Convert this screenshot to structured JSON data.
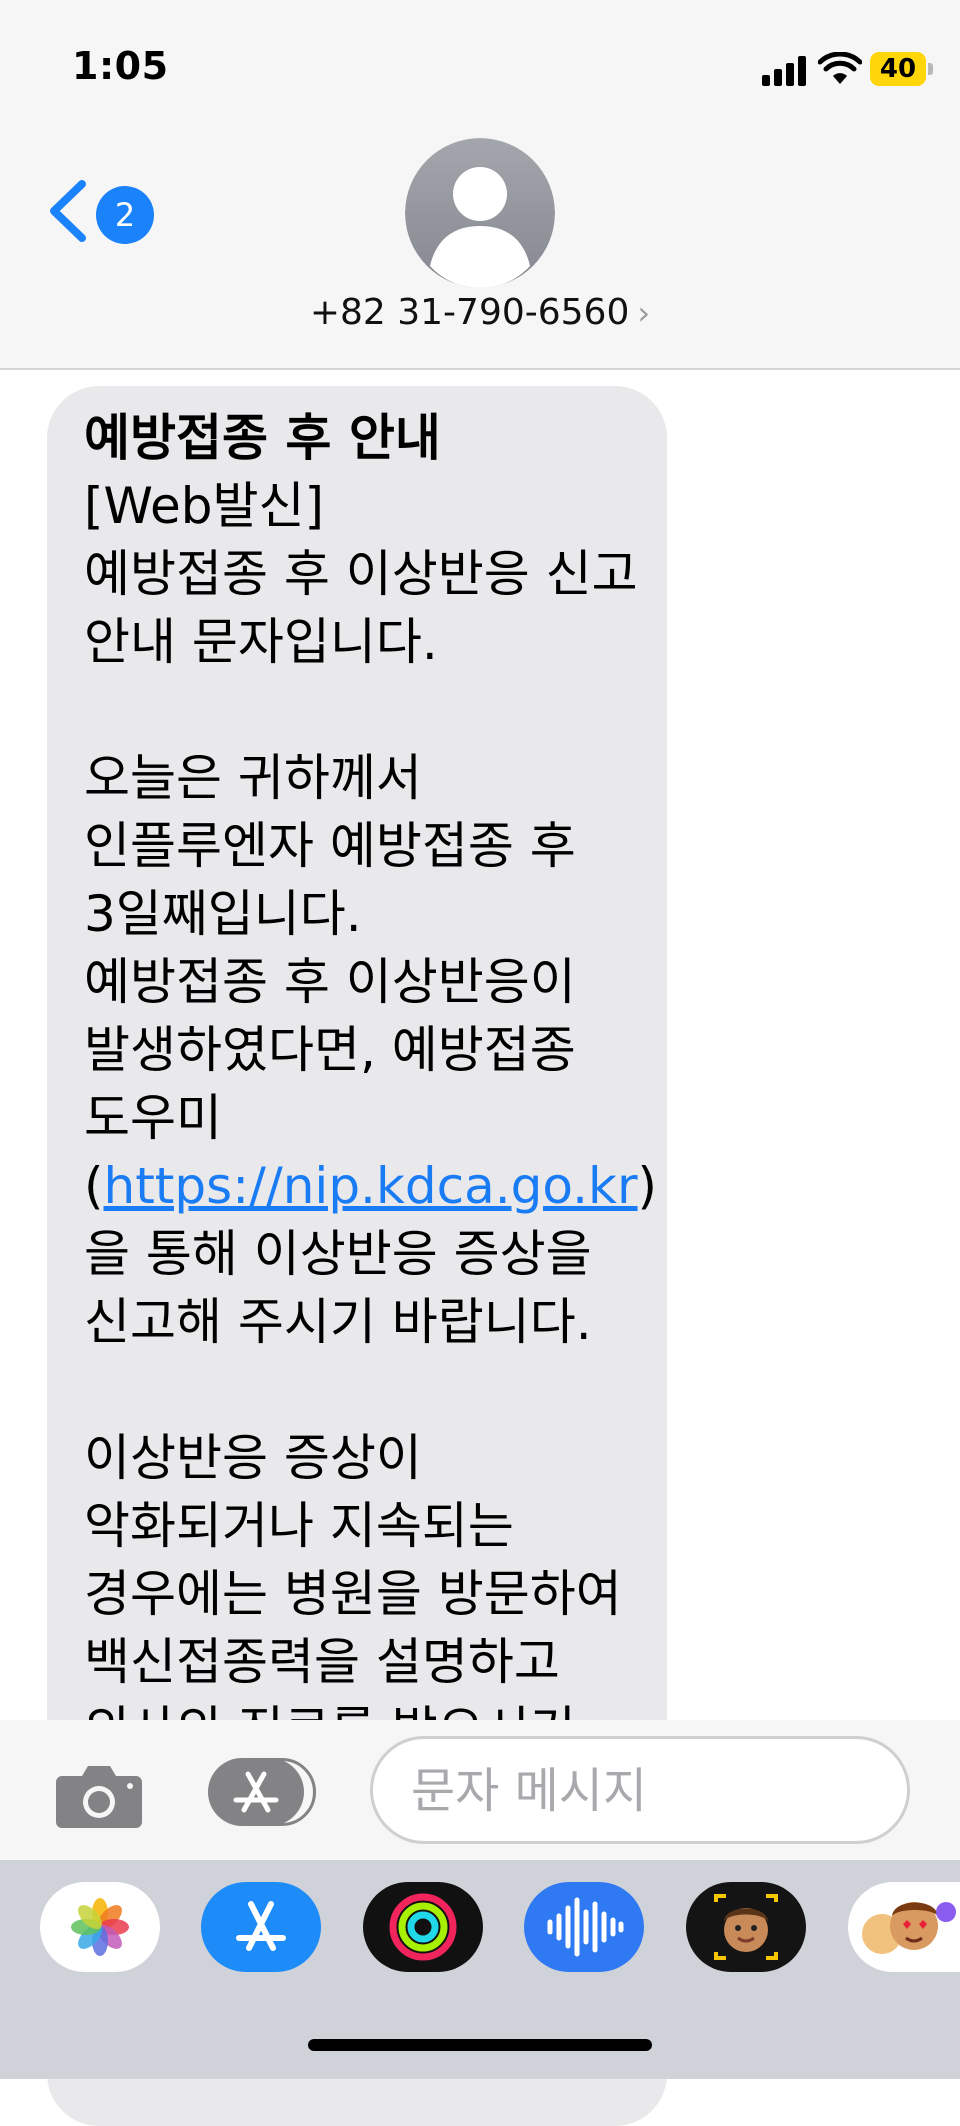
{
  "status_bar": {
    "time": "1:05",
    "battery_level": "40",
    "battery_color": "#ffd60a"
  },
  "header": {
    "back_unread_count": "2",
    "contact_number": "+82 31-790-6560",
    "disclosure": "›",
    "accent_color": "#1a82fb"
  },
  "message": {
    "title": "예방접종 후 안내",
    "body_before_link": "[Web발신]\n예방접종 후 이상반응 신고 안내 문자입니다.\n\n오늘은 귀하께서 인플루엔자 예방접종 후 3일째입니다.\n예방접종 후 이상반응이 발생하였다면, 예방접종 도우미(",
    "link": "https://nip.kdca.go.kr",
    "body_after_link": ")을 통해 이상반응 증상을 신고해 주시기 바랍니다.\n\n이상반응 증상이 악화되거나 지속되는 경우에는 병원을 방문하여 백신접종력을 설명하고 의사의 진료를 받으시기 바랍니다",
    "bubble_color": "#e9e9eb",
    "link_color": "#1a7cf5"
  },
  "input_bar": {
    "placeholder": "문자 메시지",
    "camera_icon": "camera-icon",
    "apps_icon": "app-store-icon"
  },
  "app_drawer": [
    {
      "name": "photos-app-icon"
    },
    {
      "name": "app-store-app-icon"
    },
    {
      "name": "activity-app-icon"
    },
    {
      "name": "audio-message-app-icon"
    },
    {
      "name": "memoji-app-icon"
    },
    {
      "name": "memoji-stickers-app-icon"
    }
  ]
}
